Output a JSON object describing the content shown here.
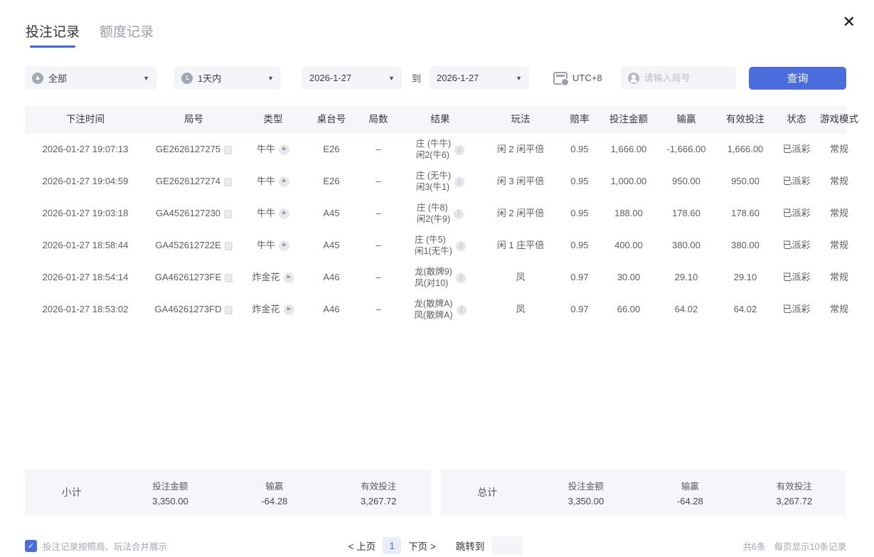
{
  "colors": {
    "accent": "#4a6ddd",
    "win_red": "#e05454",
    "loss_green": "#1db574",
    "panel_bg": "#f5f6f9"
  },
  "icons": {
    "close": "✕"
  },
  "tabs": [
    {
      "label": "投注记录",
      "active": true
    },
    {
      "label": "额度记录",
      "active": false
    }
  ],
  "filters": {
    "type_select": "全部",
    "time_select": "1天内",
    "date_from": "2026-1-27",
    "to_label": "到",
    "date_to": "2026-1-27",
    "timezone": "UTC+8",
    "search_placeholder": "请输入局号",
    "query_button": "查询"
  },
  "table": {
    "headers": {
      "time": "下注时间",
      "round": "局号",
      "type": "类型",
      "table_no": "桌台号",
      "rounds": "局数",
      "result": "结果",
      "play": "玩法",
      "odds": "赔率",
      "bet": "投注金额",
      "winloss": "输赢",
      "valid": "有效投注",
      "status": "状态",
      "mode": "游戏模式"
    },
    "rows": [
      {
        "time": "2026-01-27 19:07:13",
        "round": "GE2626127275",
        "type": "牛牛",
        "table_no": "E26",
        "rounds": "–",
        "result1": "庄 (牛牛)",
        "result2": "闲2(牛6)",
        "play": "闲 2 闲平倍",
        "odds": "0.95",
        "bet": "1,666.00",
        "winloss": "-1,666.00",
        "wl_color": "green",
        "valid": "1,666.00",
        "status": "已派彩",
        "mode": "常规"
      },
      {
        "time": "2026-01-27 19:04:59",
        "round": "GE2626127274",
        "type": "牛牛",
        "table_no": "E26",
        "rounds": "–",
        "result1": "庄 (无牛)",
        "result2": "闲3(牛1)",
        "play": "闲 3 闲平倍",
        "odds": "0.95",
        "bet": "1,000.00",
        "winloss": "950.00",
        "wl_color": "red",
        "valid": "950.00",
        "status": "已派彩",
        "mode": "常规"
      },
      {
        "time": "2026-01-27 19:03:18",
        "round": "GA4526127230",
        "type": "牛牛",
        "table_no": "A45",
        "rounds": "–",
        "result1": "庄 (牛8)",
        "result2": "闲2(牛9)",
        "play": "闲 2 闲平倍",
        "odds": "0.95",
        "bet": "188.00",
        "winloss": "178.60",
        "wl_color": "red",
        "valid": "178.60",
        "status": "已派彩",
        "mode": "常规"
      },
      {
        "time": "2026-01-27 18:58:44",
        "round": "GA452612722E",
        "type": "牛牛",
        "table_no": "A45",
        "rounds": "–",
        "result1": "庄 (牛5)",
        "result2": "闲1(无牛)",
        "play": "闲 1 庄平倍",
        "odds": "0.95",
        "bet": "400.00",
        "winloss": "380.00",
        "wl_color": "red",
        "valid": "380.00",
        "status": "已派彩",
        "mode": "常规"
      },
      {
        "time": "2026-01-27 18:54:14",
        "round": "GA46261273FE",
        "type": "炸金花",
        "table_no": "A46",
        "rounds": "–",
        "result1": "龙(散牌9)",
        "result2": "凤(对10)",
        "play": "凤",
        "odds": "0.97",
        "bet": "30.00",
        "winloss": "29.10",
        "wl_color": "red",
        "valid": "29.10",
        "status": "已派彩",
        "mode": "常规"
      },
      {
        "time": "2026-01-27 18:53:02",
        "round": "GA46261273FD",
        "type": "炸金花",
        "table_no": "A46",
        "rounds": "–",
        "result1": "龙(散牌A)",
        "result2": "凤(散牌A)",
        "play": "凤",
        "odds": "0.97",
        "bet": "66.00",
        "winloss": "64.02",
        "wl_color": "red",
        "valid": "64.02",
        "status": "已派彩",
        "mode": "常规"
      }
    ]
  },
  "summary": {
    "subtotal": {
      "label": "小计",
      "bet_label": "投注金额",
      "bet": "3,350.00",
      "winloss_label": "输赢",
      "winloss": "-64.28",
      "valid_label": "有效投注",
      "valid": "3,267.72"
    },
    "total": {
      "label": "总计",
      "bet_label": "投注金额",
      "bet": "3,350.00",
      "winloss_label": "输赢",
      "winloss": "-64.28",
      "valid_label": "有效投注",
      "valid": "3,267.72"
    }
  },
  "footer": {
    "merge_label": "投注记录按照局、玩法合并展示",
    "merge_checked": true,
    "prev": "< 上页",
    "current_page": "1",
    "next": "下页 >",
    "jump_label": "跳转到",
    "jump_value": "",
    "total_count": "共6条",
    "page_size": "每页显示10条记录"
  }
}
